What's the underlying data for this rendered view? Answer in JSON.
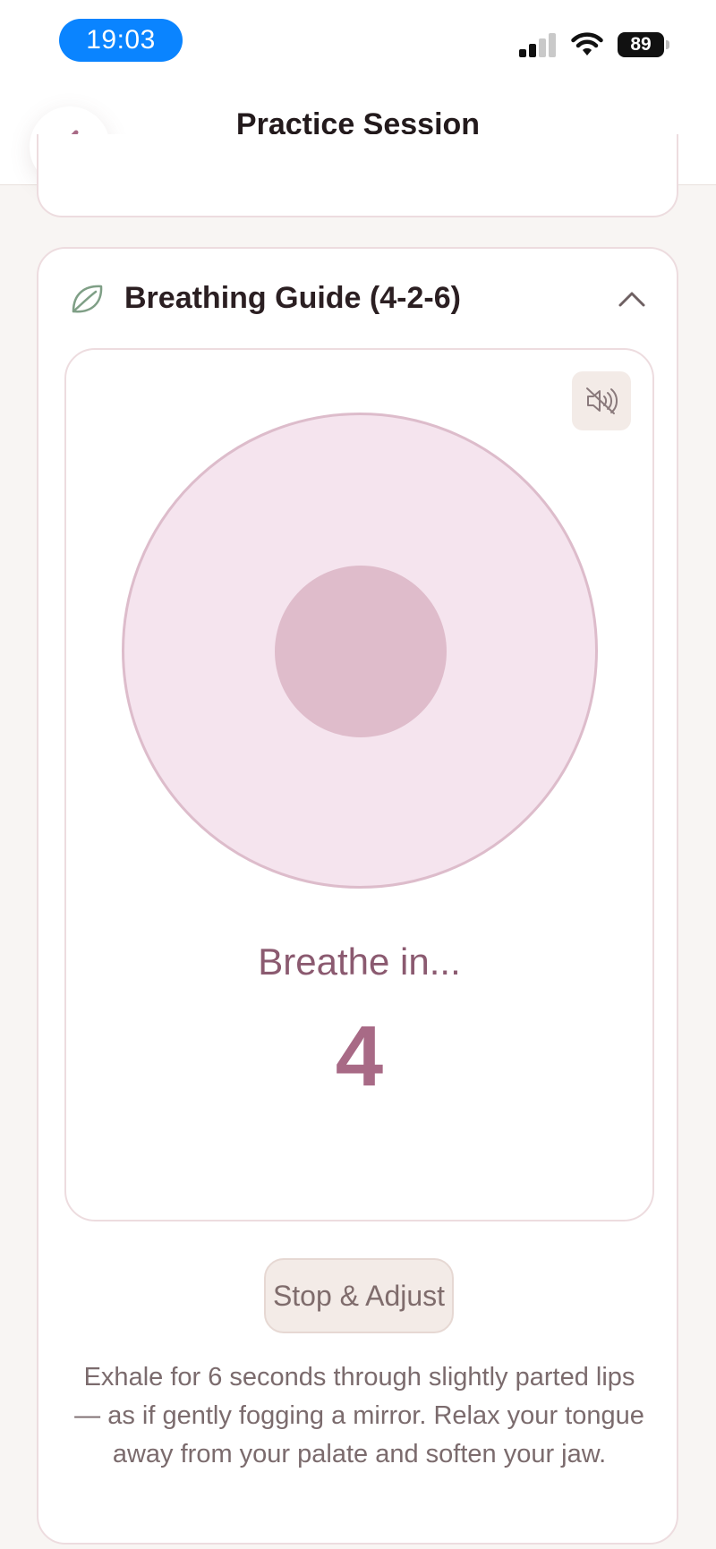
{
  "status_bar": {
    "time": "19:03",
    "battery": "89"
  },
  "nav": {
    "title": "Practice Session",
    "back_icon": "chevron-left-icon"
  },
  "breathing_guide": {
    "title": "Breathing Guide (4-2-6)",
    "leaf_icon": "leaf-icon",
    "collapse_icon": "chevron-up-icon",
    "mute_icon": "speaker-muted-icon",
    "phase": "Breathe in...",
    "count": "4",
    "stop_button": "Stop & Adjust",
    "instructions": "Exhale for 6 seconds through slightly parted lips — as if gently fogging a mirror. Relax your tongue away from your palate and soften your jaw."
  },
  "colors": {
    "accent": "#a86a86",
    "circle_outer": "#f5e4ee",
    "circle_inner": "#dfbccb",
    "time_pill": "#0a84ff"
  }
}
